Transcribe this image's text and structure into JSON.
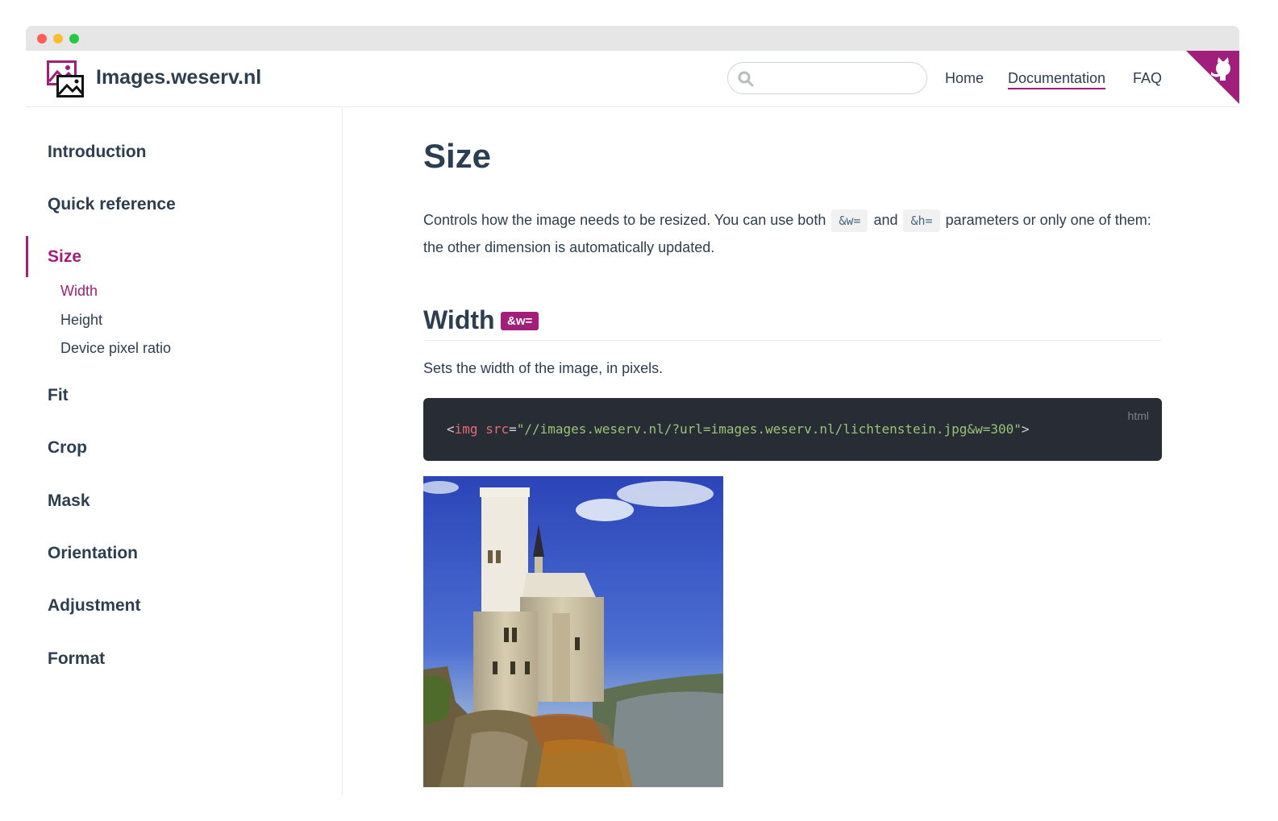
{
  "site": {
    "name": "Images.weserv.nl",
    "logo_icon": "images-logo-icon",
    "brand_color": "#a11e7a"
  },
  "nav": {
    "search_placeholder": "",
    "links": [
      {
        "label": "Home"
      },
      {
        "label": "Documentation",
        "active": true
      },
      {
        "label": "FAQ"
      }
    ],
    "corner_icon": "github-octocat-icon"
  },
  "sidebar": {
    "items": [
      {
        "label": "Introduction"
      },
      {
        "label": "Quick reference"
      },
      {
        "label": "Size",
        "active": true
      },
      {
        "label": "Fit"
      },
      {
        "label": "Crop"
      },
      {
        "label": "Mask"
      },
      {
        "label": "Orientation"
      },
      {
        "label": "Adjustment"
      },
      {
        "label": "Format"
      }
    ],
    "subitems": [
      {
        "label": "Width",
        "active": true
      },
      {
        "label": "Height"
      },
      {
        "label": "Device pixel ratio"
      }
    ]
  },
  "main": {
    "title": "Size",
    "intro": {
      "part1": "Controls how the image needs to be resized. You can use both ",
      "code1": "&w=",
      "part2": " and ",
      "code2": "&h=",
      "part3": " parameters or only one of them: the other dimension is automatically updated."
    },
    "section": {
      "title": "Width",
      "badge": "&w=",
      "description": "Sets the width of the image, in pixels.",
      "code": {
        "lang": "html",
        "lt": "<",
        "tag": "img",
        "attr": "src",
        "eq": "=",
        "value": "\"//images.weserv.nl/?url=images.weserv.nl/lichtenstein.jpg&w=300\"",
        "gt": ">"
      },
      "image_alt": "Lichtenstein castle"
    }
  }
}
